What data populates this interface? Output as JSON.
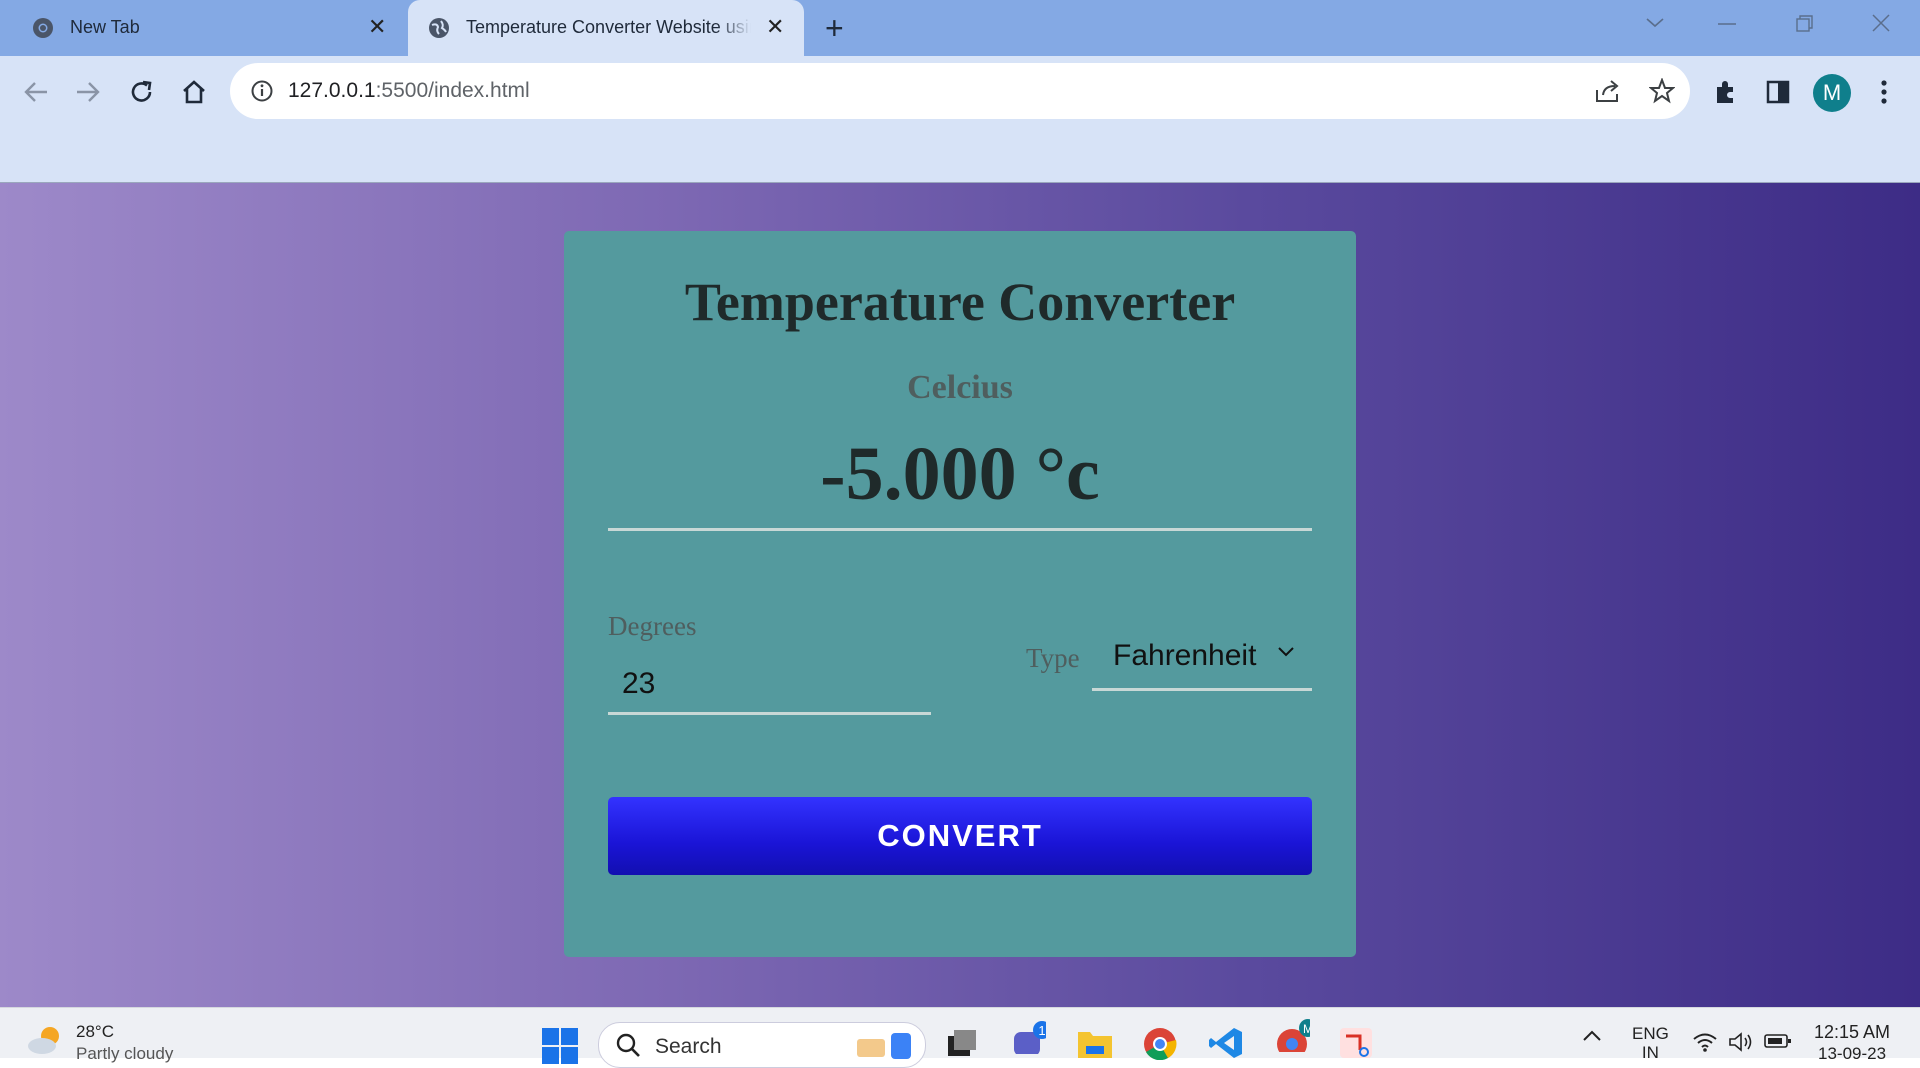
{
  "browser": {
    "tabs": [
      {
        "title": "New Tab",
        "active": false
      },
      {
        "title": "Temperature Converter Website using HTML CSS and JavaScript",
        "active": true
      }
    ],
    "new_tab_symbol": "+",
    "close_symbol": "✕",
    "address": {
      "host": "127.0.0.1",
      "path": ":5500/index.html"
    },
    "profile_initial": "M",
    "icons": [
      "back-icon",
      "forward-icon",
      "reload-icon",
      "home-icon",
      "site-info-icon",
      "share-icon",
      "bookmark-star-icon",
      "extensions-icon",
      "side-panel-icon",
      "menu-kebab-icon"
    ]
  },
  "converter": {
    "title": "Temperature Converter",
    "result_unit_label": "Celcius",
    "result_value": "-5.000 °c",
    "degrees_label": "Degrees",
    "degrees_value": "23",
    "type_label": "Type",
    "type_selected": "Fahrenheit",
    "convert_label": "CONVERT"
  },
  "taskbar": {
    "weather_temp": "28°C",
    "weather_desc": "Partly cloudy",
    "search_placeholder": "Search",
    "chat_badge": "1",
    "chrome_badge": "M",
    "lang_top": "ENG",
    "lang_bottom": "IN",
    "time": "12:15 AM",
    "date": "13-09-23"
  },
  "colors": {
    "tabbar": "#84a9e4",
    "toolbar": "#d7e3f7",
    "card": "#549a9e",
    "button": "#2222e6",
    "avatar": "#0f7f8c"
  }
}
